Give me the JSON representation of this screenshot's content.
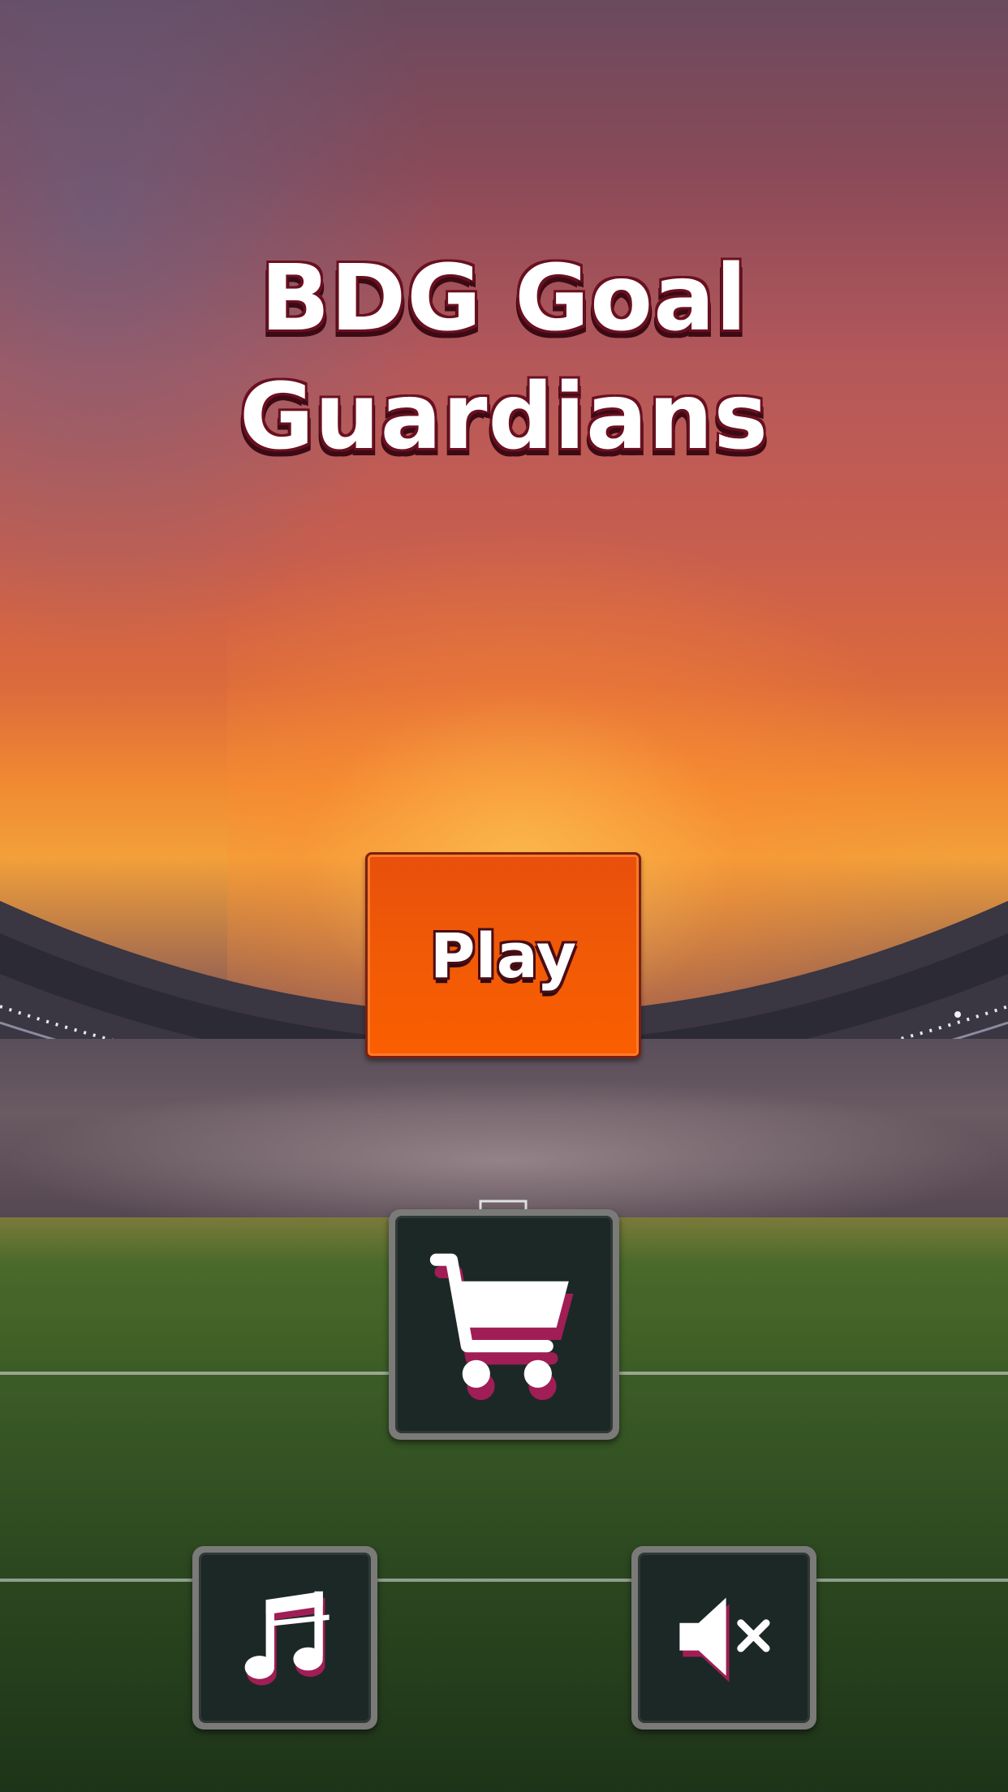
{
  "title": {
    "line1": "BDG Goal",
    "line2": "Guardians"
  },
  "menu": {
    "play_label": "Play",
    "shop_icon": "shopping-cart-icon",
    "music_icon": "music-note-icon",
    "sound_icon": "speaker-muted-icon"
  },
  "colors": {
    "play_button": "#F15A06",
    "icon_button_bg": "#1C2826",
    "icon_white": "#FFFFFF",
    "icon_shadow": "#A01E55",
    "title_outline": "#6A1020"
  }
}
